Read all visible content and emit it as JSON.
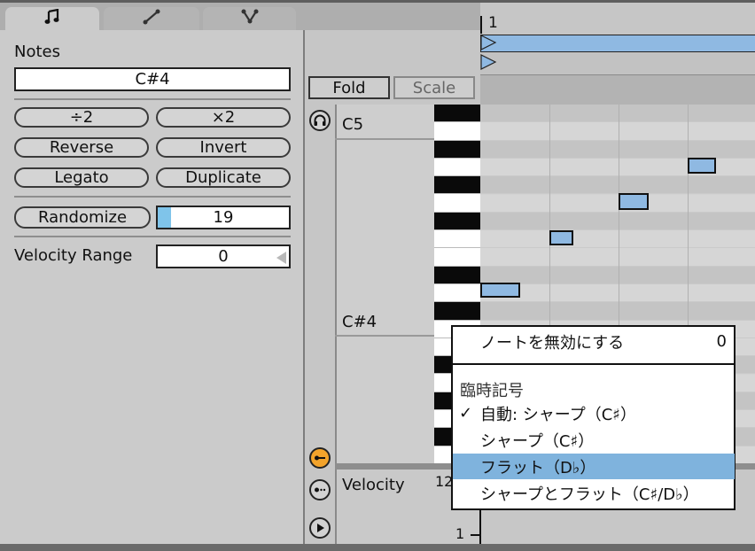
{
  "tabs": [
    {
      "icon": "note-icon",
      "active": true
    },
    {
      "icon": "pencil-icon",
      "active": false
    },
    {
      "icon": "node-icon",
      "active": false
    }
  ],
  "notes_panel": {
    "title": "Notes",
    "pitch_value": "C#4",
    "buttons": {
      "divide": "÷2",
      "multiply": "×2",
      "reverse": "Reverse",
      "invert": "Invert",
      "legato": "Legato",
      "duplicate": "Duplicate",
      "randomize": "Randomize"
    },
    "randomize_value": "19",
    "randomize_fill": 0.1,
    "velocity_range_label": "Velocity Range",
    "velocity_range_value": "0"
  },
  "editor": {
    "fold": "Fold",
    "scale": "Scale",
    "bar_number": "1",
    "key_labels": {
      "c5": "C5",
      "cs4": "C#4"
    },
    "velocity_label": "Velocity",
    "velocity_top": "12",
    "velocity_bottom": "1",
    "colors": {
      "note": "#8fb9e2",
      "accent": "#f2a32b",
      "highlight": "#7fb3dd"
    }
  },
  "context_menu": {
    "disable_note": "ノートを無効にする",
    "disable_note_value": "0",
    "section_title": "臨時記号",
    "check_mark": "✓",
    "items": [
      {
        "label": "自動: シャープ（C♯）",
        "checked": true,
        "highlighted": false
      },
      {
        "label": "シャープ（C♯）",
        "checked": false,
        "highlighted": false
      },
      {
        "label": "フラット（D♭）",
        "checked": false,
        "highlighted": true
      },
      {
        "label": "シャープとフラット（C♯/D♭）",
        "checked": false,
        "highlighted": false
      }
    ]
  }
}
